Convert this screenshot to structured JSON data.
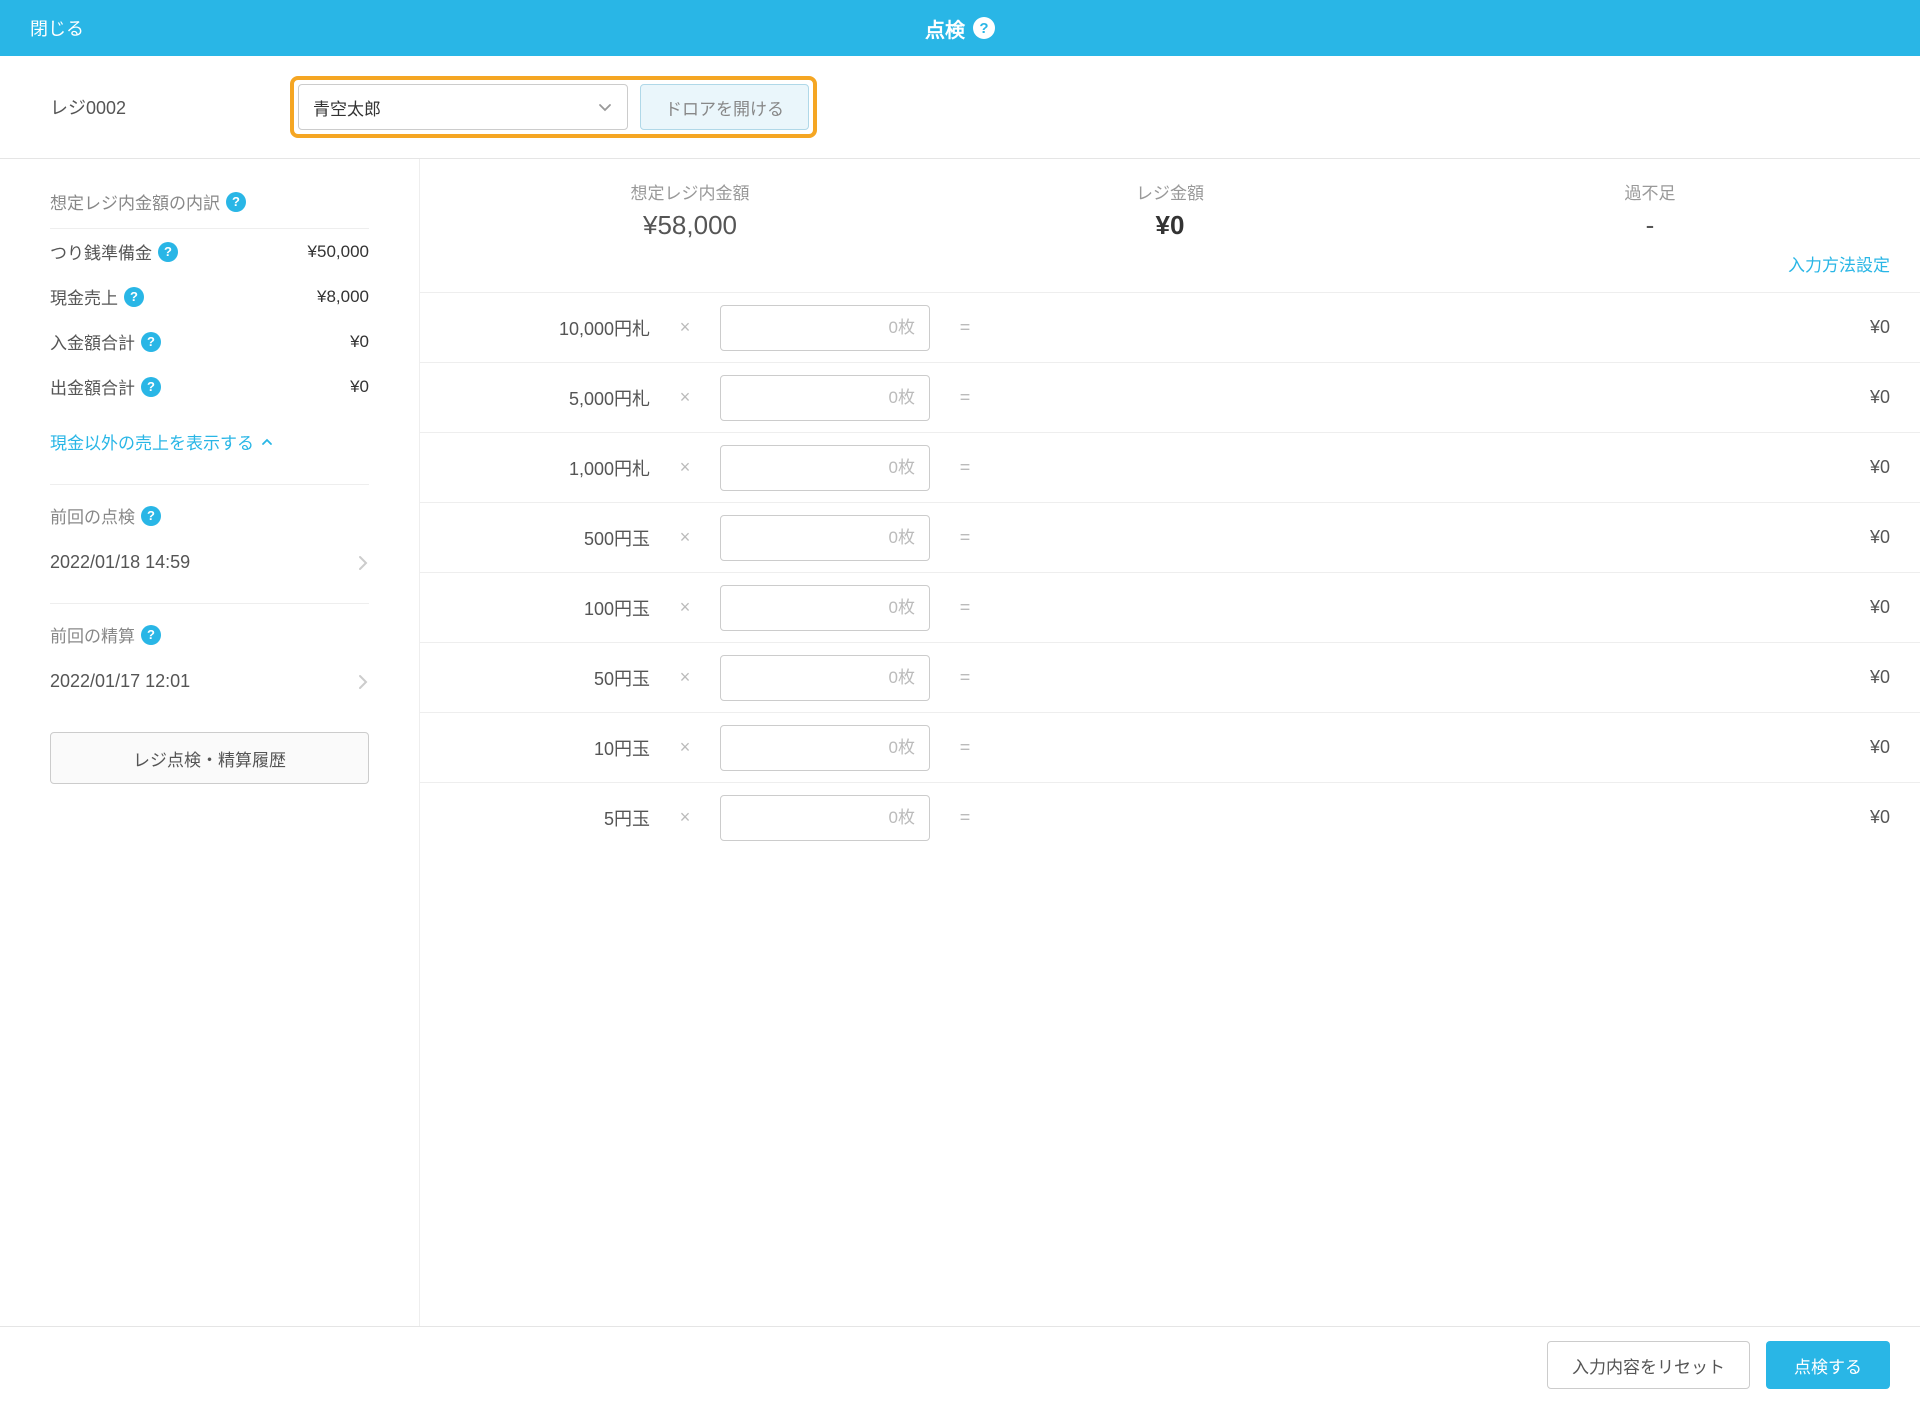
{
  "header": {
    "close": "閉じる",
    "title": "点検"
  },
  "toolbar": {
    "register": "レジ0002",
    "staff": "青空太郎",
    "open_drawer": "ドロアを開ける"
  },
  "sidebar": {
    "breakdown_title": "想定レジ内金額の内訳",
    "items": [
      {
        "label": "つり銭準備金",
        "value": "¥50,000"
      },
      {
        "label": "現金売上",
        "value": "¥8,000"
      },
      {
        "label": "入金額合計",
        "value": "¥0"
      },
      {
        "label": "出金額合計",
        "value": "¥0"
      }
    ],
    "toggle": "現金以外の売上を表示する",
    "last_check": {
      "title": "前回の点検",
      "value": "2022/01/18 14:59"
    },
    "last_settlement": {
      "title": "前回の精算",
      "value": "2022/01/17 12:01"
    },
    "history_btn": "レジ点検・精算履歴"
  },
  "summary": {
    "expected_label": "想定レジ内金額",
    "expected_value": "¥58,000",
    "actual_label": "レジ金額",
    "actual_value": "¥0",
    "diff_label": "過不足",
    "diff_value": "-"
  },
  "input_setting": "入力方法設定",
  "denominations": [
    {
      "label": "10,000円札",
      "placeholder": "0枚",
      "total": "¥0"
    },
    {
      "label": "5,000円札",
      "placeholder": "0枚",
      "total": "¥0"
    },
    {
      "label": "1,000円札",
      "placeholder": "0枚",
      "total": "¥0"
    },
    {
      "label": "500円玉",
      "placeholder": "0枚",
      "total": "¥0"
    },
    {
      "label": "100円玉",
      "placeholder": "0枚",
      "total": "¥0"
    },
    {
      "label": "50円玉",
      "placeholder": "0枚",
      "total": "¥0"
    },
    {
      "label": "10円玉",
      "placeholder": "0枚",
      "total": "¥0"
    },
    {
      "label": "5円玉",
      "placeholder": "0枚",
      "total": "¥0"
    }
  ],
  "footer": {
    "reset": "入力内容をリセット",
    "submit": "点検する"
  }
}
